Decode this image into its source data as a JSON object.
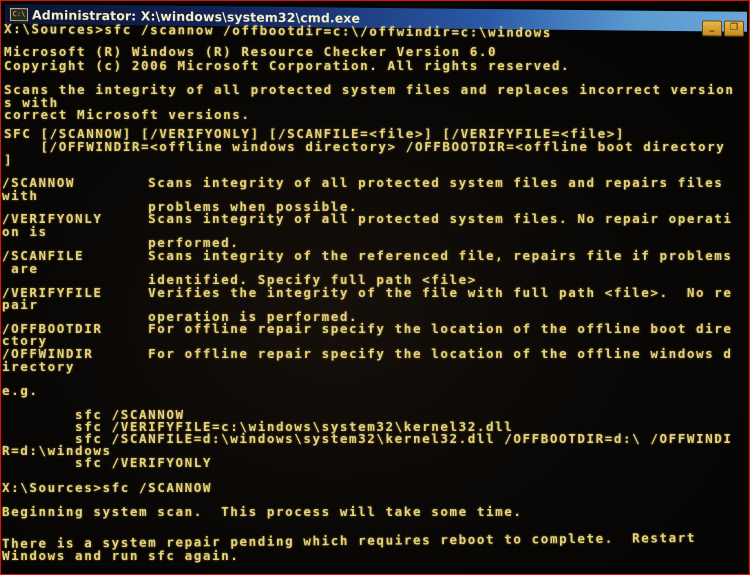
{
  "window": {
    "title": "Administrator: X:\\windows\\system32\\cmd.exe",
    "icon": "console-icon",
    "icon_glyph": "C:\\",
    "controls": {
      "minimize_glyph": "_",
      "maximize_glyph": "❐"
    }
  },
  "console": {
    "lines": [
      "X:\\Sources>sfc /scannow /offbootdir=c:\\/offwindir=c:\\windows",
      "Microsoft (R) Windows (R) Resource Checker Version 6.0",
      "Copyright (c) 2006 Microsoft Corporation. All rights reserved.",
      "Scans the integrity of all protected system files and replaces incorrect version",
      "s with",
      "correct Microsoft versions.",
      "SFC [/SCANNOW] [/VERIFYONLY] [/SCANFILE=<file>] [/VERIFYFILE=<file>]",
      "    [/OFFWINDIR=<offline windows directory> /OFFBOOTDIR=<offline boot directory",
      "]",
      "/SCANNOW        Scans integrity of all protected system files and repairs files",
      "with",
      "                problems when possible.",
      "/VERIFYONLY     Scans integrity of all protected system files. No repair operati",
      "on is",
      "                performed.",
      "/SCANFILE       Scans integrity of the referenced file, repairs file if problems",
      " are",
      "                identified. Specify full path <file>",
      "/VERIFYFILE     Verifies the integrity of the file with full path <file>.  No re",
      "pair",
      "                operation is performed.",
      "/OFFBOOTDIR     For offline repair specify the location of the offline boot dire",
      "ctory",
      "/OFFWINDIR      For offline repair specify the location of the offline windows d",
      "irectory",
      "e.g.",
      "        sfc /SCANNOW",
      "        sfc /VERIFYFILE=c:\\windows\\system32\\kernel32.dll",
      "        sfc /SCANFILE=d:\\windows\\system32\\kernel32.dll /OFFBOOTDIR=d:\\ /OFFWINDI",
      "R=d:\\windows",
      "        sfc /VERIFYONLY",
      "X:\\Sources>sfc /SCANNOW",
      "Beginning system scan.  This process will take some time.",
      "There is a system repair pending which requires reboot to complete.  Restart",
      "Windows and run sfc again."
    ]
  }
}
